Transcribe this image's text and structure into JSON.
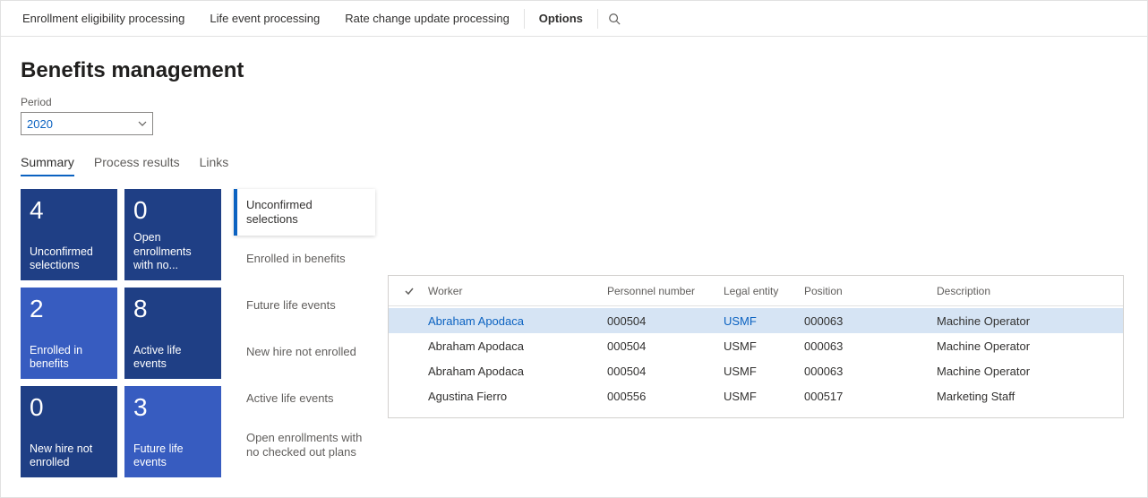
{
  "topbar": {
    "items": [
      {
        "label": "Enrollment eligibility processing",
        "bold": false
      },
      {
        "label": "Life event processing",
        "bold": false
      },
      {
        "label": "Rate change update processing",
        "bold": false
      },
      {
        "label": "Options",
        "bold": true
      }
    ]
  },
  "page_title": "Benefits management",
  "period": {
    "label": "Period",
    "value": "2020"
  },
  "tabs": [
    {
      "label": "Summary",
      "active": true
    },
    {
      "label": "Process results",
      "active": false
    },
    {
      "label": "Links",
      "active": false
    }
  ],
  "tiles": [
    {
      "count": "4",
      "label": "Unconfirmed selections",
      "variant": "dark"
    },
    {
      "count": "0",
      "label": "Open enrollments with no...",
      "variant": "dark"
    },
    {
      "count": "2",
      "label": "Enrolled in benefits",
      "variant": "light"
    },
    {
      "count": "8",
      "label": "Active life events",
      "variant": "dark"
    },
    {
      "count": "0",
      "label": "New hire not enrolled",
      "variant": "dark"
    },
    {
      "count": "3",
      "label": "Future life events",
      "variant": "light"
    }
  ],
  "sidelist": [
    {
      "label": "Unconfirmed selections",
      "active": true
    },
    {
      "label": "Enrolled in benefits",
      "active": false
    },
    {
      "label": "Future life events",
      "active": false
    },
    {
      "label": "New hire not enrolled",
      "active": false
    },
    {
      "label": "Active life events",
      "active": false
    },
    {
      "label": "Open enrollments with no checked out plans",
      "active": false
    }
  ],
  "grid": {
    "headers": {
      "worker": "Worker",
      "personnel": "Personnel number",
      "legal": "Legal entity",
      "position": "Position",
      "description": "Description"
    },
    "rows": [
      {
        "worker": "Abraham Apodaca",
        "personnel": "000504",
        "legal": "USMF",
        "position": "000063",
        "description": "Machine Operator",
        "selected": true
      },
      {
        "worker": "Abraham Apodaca",
        "personnel": "000504",
        "legal": "USMF",
        "position": "000063",
        "description": "Machine Operator",
        "selected": false
      },
      {
        "worker": "Abraham Apodaca",
        "personnel": "000504",
        "legal": "USMF",
        "position": "000063",
        "description": "Machine Operator",
        "selected": false
      },
      {
        "worker": "Agustina Fierro",
        "personnel": "000556",
        "legal": "USMF",
        "position": "000517",
        "description": "Marketing Staff",
        "selected": false
      }
    ]
  }
}
